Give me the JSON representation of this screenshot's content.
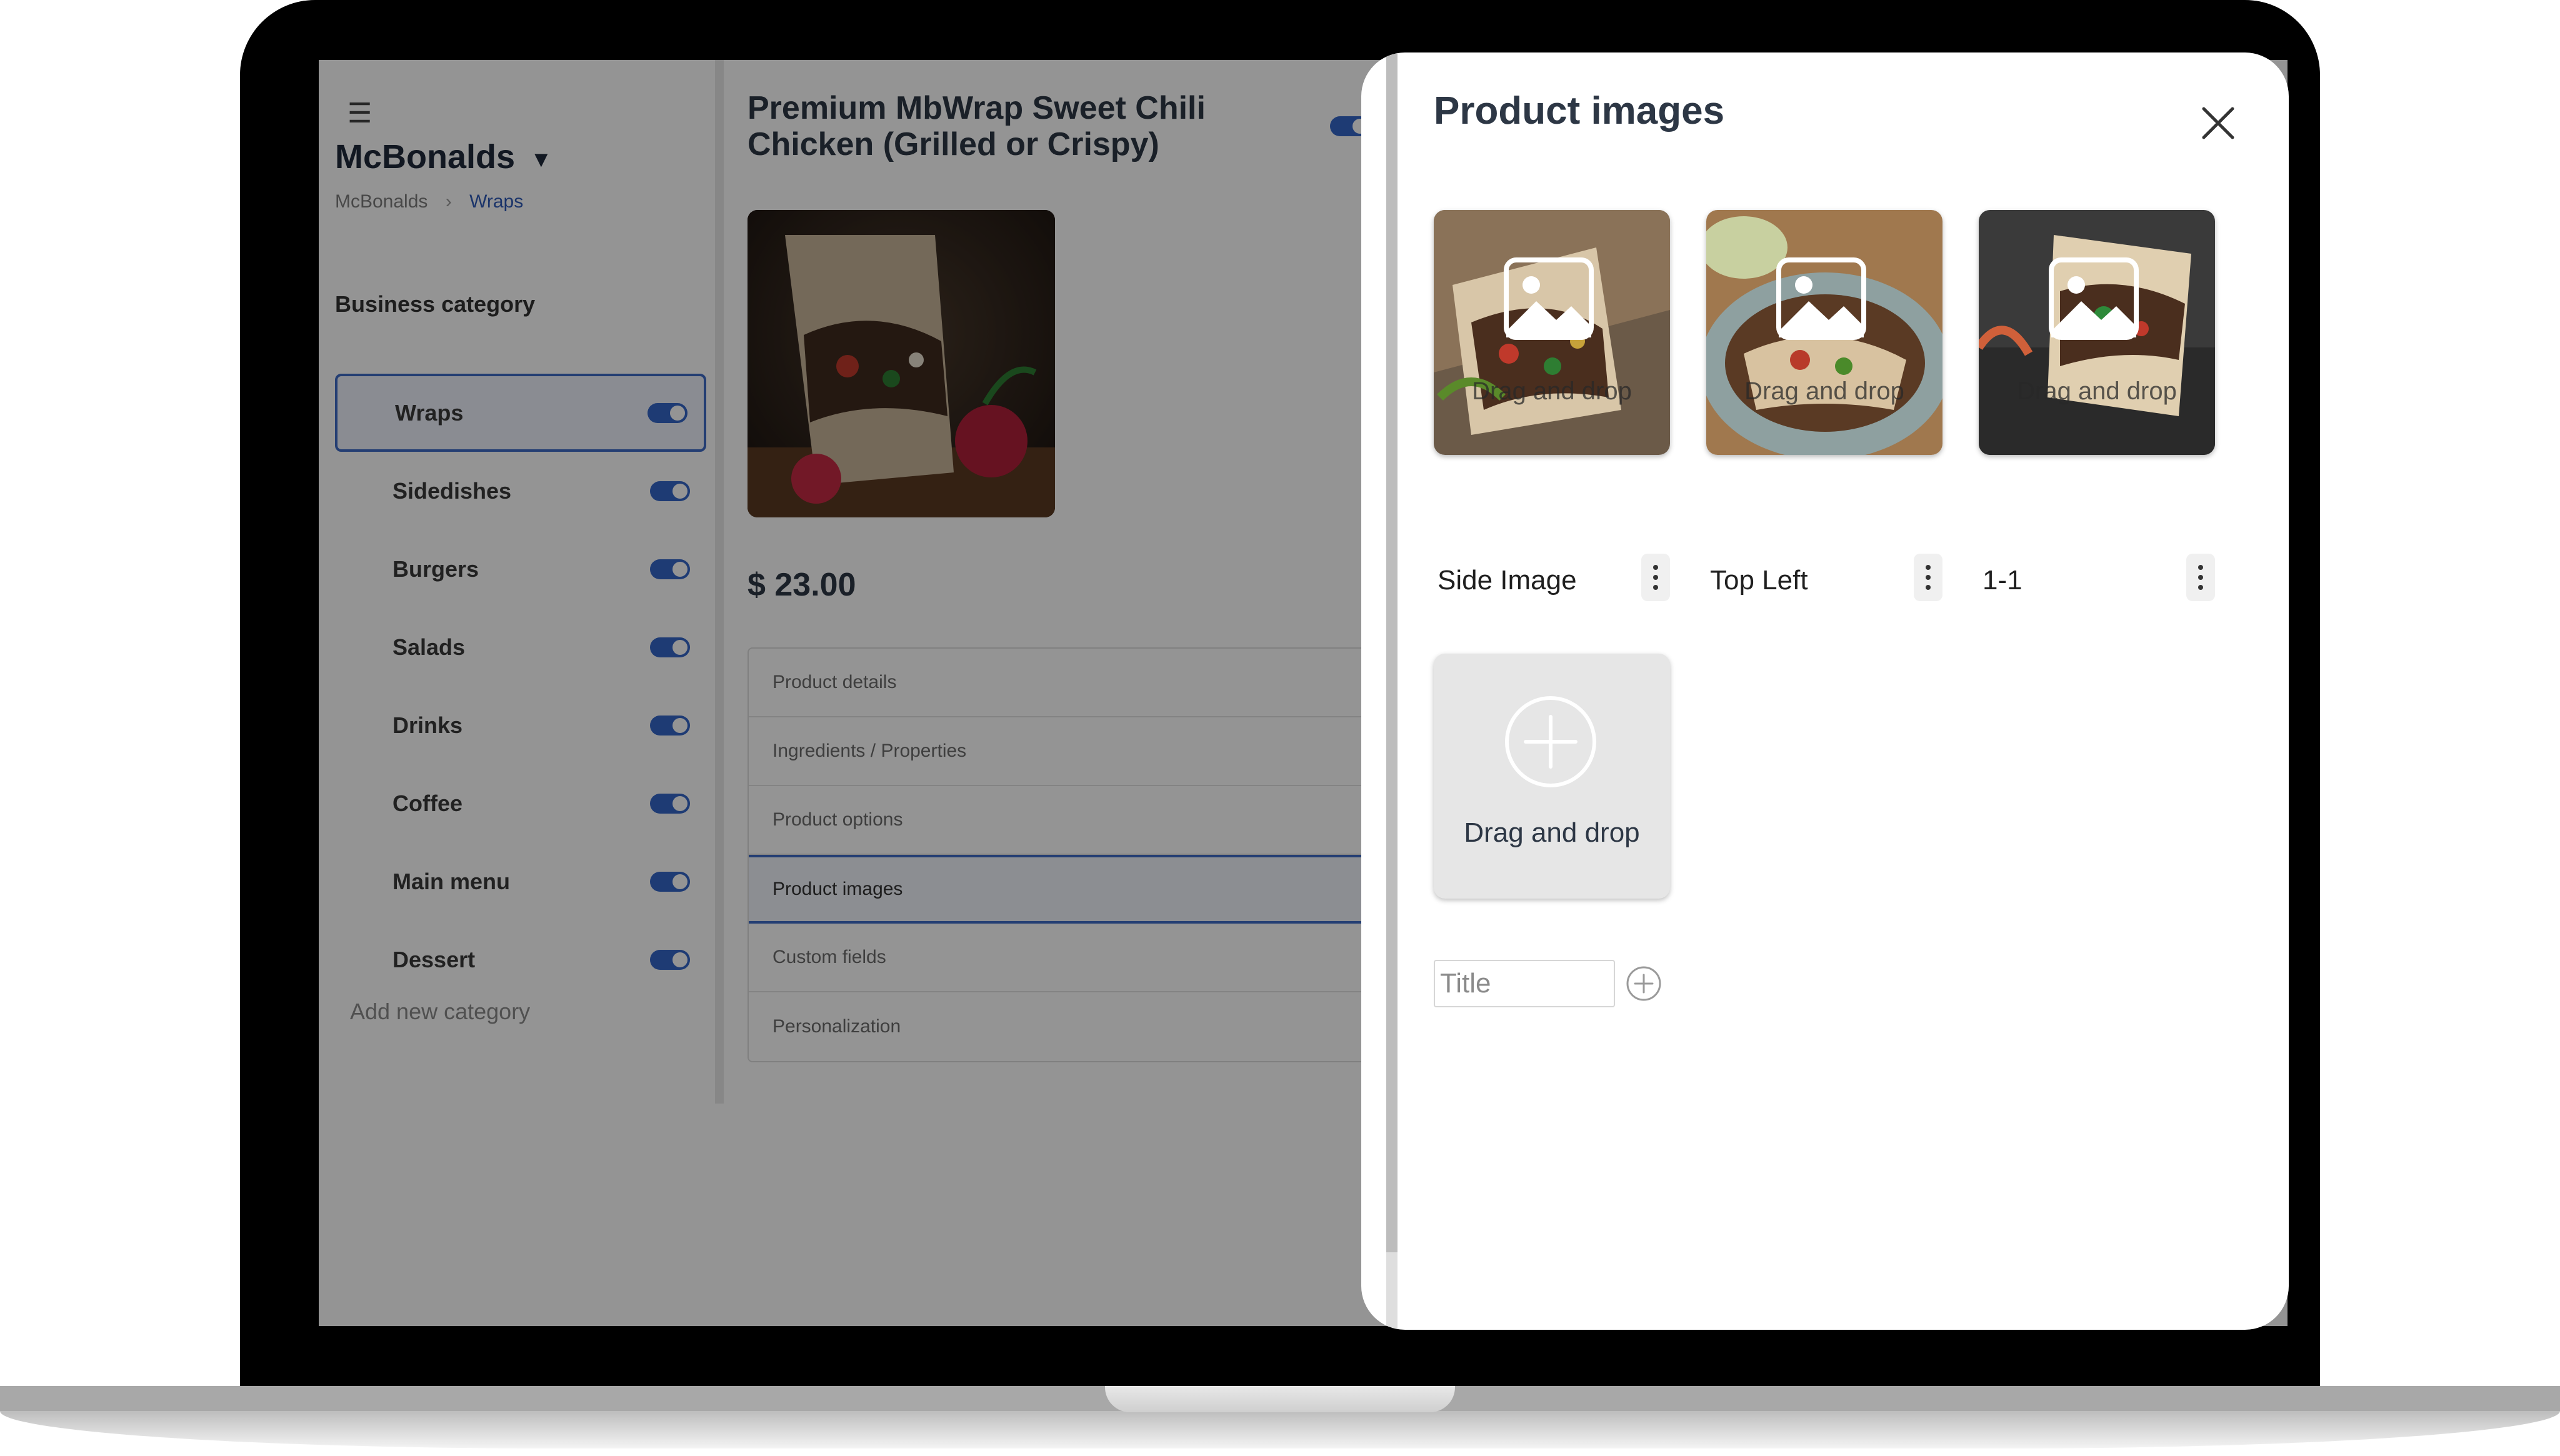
{
  "sidebar": {
    "brand": "McBonalds",
    "breadcrumb": [
      "McBonalds",
      "Wraps"
    ],
    "section_title": "Business category",
    "categories": [
      {
        "label": "Wraps",
        "enabled": true,
        "active": true
      },
      {
        "label": "Sidedishes",
        "enabled": true
      },
      {
        "label": "Burgers",
        "enabled": true
      },
      {
        "label": "Salads",
        "enabled": true
      },
      {
        "label": "Drinks",
        "enabled": true
      },
      {
        "label": "Coffee",
        "enabled": true
      },
      {
        "label": "Main menu",
        "enabled": true
      },
      {
        "label": "Dessert",
        "enabled": true
      }
    ],
    "add_category": "Add new category"
  },
  "product": {
    "title": "Premium MbWrap Sweet Chili Chicken (Grilled or Crispy)",
    "price": "$ 23.00",
    "enabled": true,
    "tabs": [
      "Product details",
      "Ingredients / Properties",
      "Product options",
      "Product images",
      "Custom fields",
      "Personalization"
    ],
    "selected_tab": "Product images"
  },
  "modal": {
    "title": "Product images",
    "images": [
      {
        "caption": "Side Image",
        "drop_label": "Drag and drop"
      },
      {
        "caption": "Top Left",
        "drop_label": "Drag and drop"
      },
      {
        "caption": "1-1",
        "drop_label": "Drag and drop"
      }
    ],
    "add_slot": {
      "drop_label": "Drag and drop"
    },
    "title_input": {
      "placeholder": "Title",
      "value": ""
    }
  },
  "colors": {
    "accent": "#3566c9",
    "text_dark": "#2d3745",
    "overlay": "#000000"
  }
}
